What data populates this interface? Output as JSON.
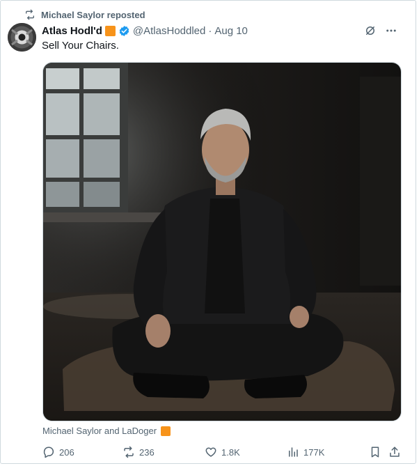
{
  "repost": {
    "text": "Michael Saylor reposted",
    "icon": "repost-icon"
  },
  "author": {
    "display_name": "Atlas Hodl'd",
    "handle": "@AtlasHoddled",
    "separator": "·",
    "date": "Aug 10",
    "avatar_icon": "avatar",
    "verified_icon": "verified-badge-icon",
    "badge_color": "#f7931a"
  },
  "tweet": {
    "text": "Sell Your Chairs."
  },
  "media": {
    "alt_icon": "photo-man-sitting-cross-legged"
  },
  "tagged": {
    "text": "Michael Saylor and LaDoger"
  },
  "actions": {
    "replies": "206",
    "reposts": "236",
    "likes": "1.8K",
    "views": "177K"
  },
  "colors": {
    "accent": "#1d9bf0",
    "muted": "#536471",
    "bitcoin_orange": "#f7931a"
  }
}
